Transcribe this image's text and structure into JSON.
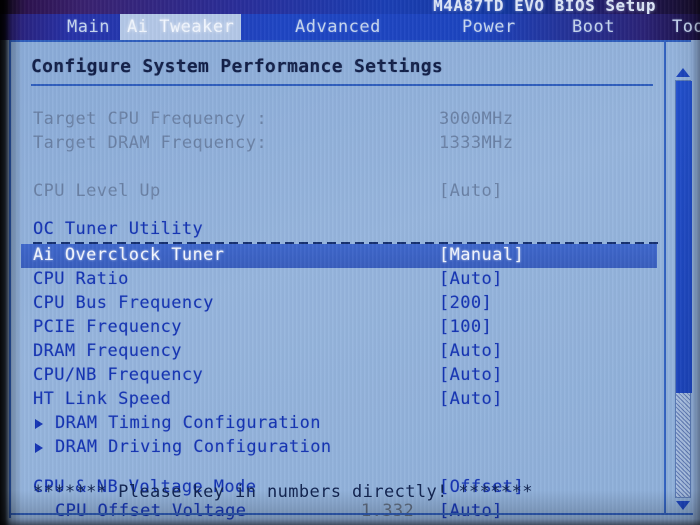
{
  "window": {
    "title": "M4A87TD EVO BIOS Setup"
  },
  "menubar": {
    "tabs": [
      {
        "label": "Main",
        "selected": false
      },
      {
        "label": "Ai Tweaker",
        "selected": true
      },
      {
        "label": "Advanced",
        "selected": false
      },
      {
        "label": "Power",
        "selected": false
      },
      {
        "label": "Boot",
        "selected": false
      },
      {
        "label": "Too",
        "selected": false
      }
    ]
  },
  "page": {
    "title": "Configure System Performance Settings",
    "warning": "******* Please key in numbers directly! *******"
  },
  "rows": [
    {
      "label": "Target CPU Frequency :",
      "value": "3000MHz",
      "state": "dim"
    },
    {
      "label": "Target DRAM Frequency:",
      "value": "1333MHz",
      "state": "dim"
    },
    {
      "label": "CPU Level Up",
      "value": "[Auto]",
      "state": "dim"
    },
    {
      "label": "OC Tuner Utility",
      "value": "",
      "state": "norm"
    },
    {
      "label": "Ai Overclock Tuner",
      "value": "[Manual]",
      "state": "selected"
    },
    {
      "label": "CPU Ratio",
      "value": "[Auto]",
      "state": "norm"
    },
    {
      "label": "CPU Bus Frequency",
      "value": "[200]",
      "state": "norm"
    },
    {
      "label": "PCIE Frequency",
      "value": "[100]",
      "state": "norm"
    },
    {
      "label": "DRAM Frequency",
      "value": "[Auto]",
      "state": "norm"
    },
    {
      "label": "CPU/NB Frequency",
      "value": "[Auto]",
      "state": "norm"
    },
    {
      "label": "HT Link Speed",
      "value": "[Auto]",
      "state": "norm"
    },
    {
      "label": "DRAM Timing Configuration",
      "value": "",
      "state": "norm",
      "submenu": true
    },
    {
      "label": "DRAM Driving Configuration",
      "value": "",
      "state": "norm",
      "submenu": true
    },
    {
      "label": "CPU & NB Voltage Mode",
      "value": "[Offset]",
      "state": "norm"
    },
    {
      "label": "CPU Offset Voltage",
      "value": "[Auto]",
      "state": "norm",
      "midvalue": "1.332",
      "indent": true
    }
  ],
  "scrollbar": {
    "up_icon": "triangle-up-icon",
    "down_icon": "triangle-down-icon",
    "thumb_position_percent": 0,
    "thumb_size_percent": 75
  },
  "colors": {
    "background": "#8fadd8",
    "accent": "#1534b4",
    "selection": "#3c63c4",
    "dim_text": "#6b82a6",
    "dark_text": "#10224f"
  }
}
